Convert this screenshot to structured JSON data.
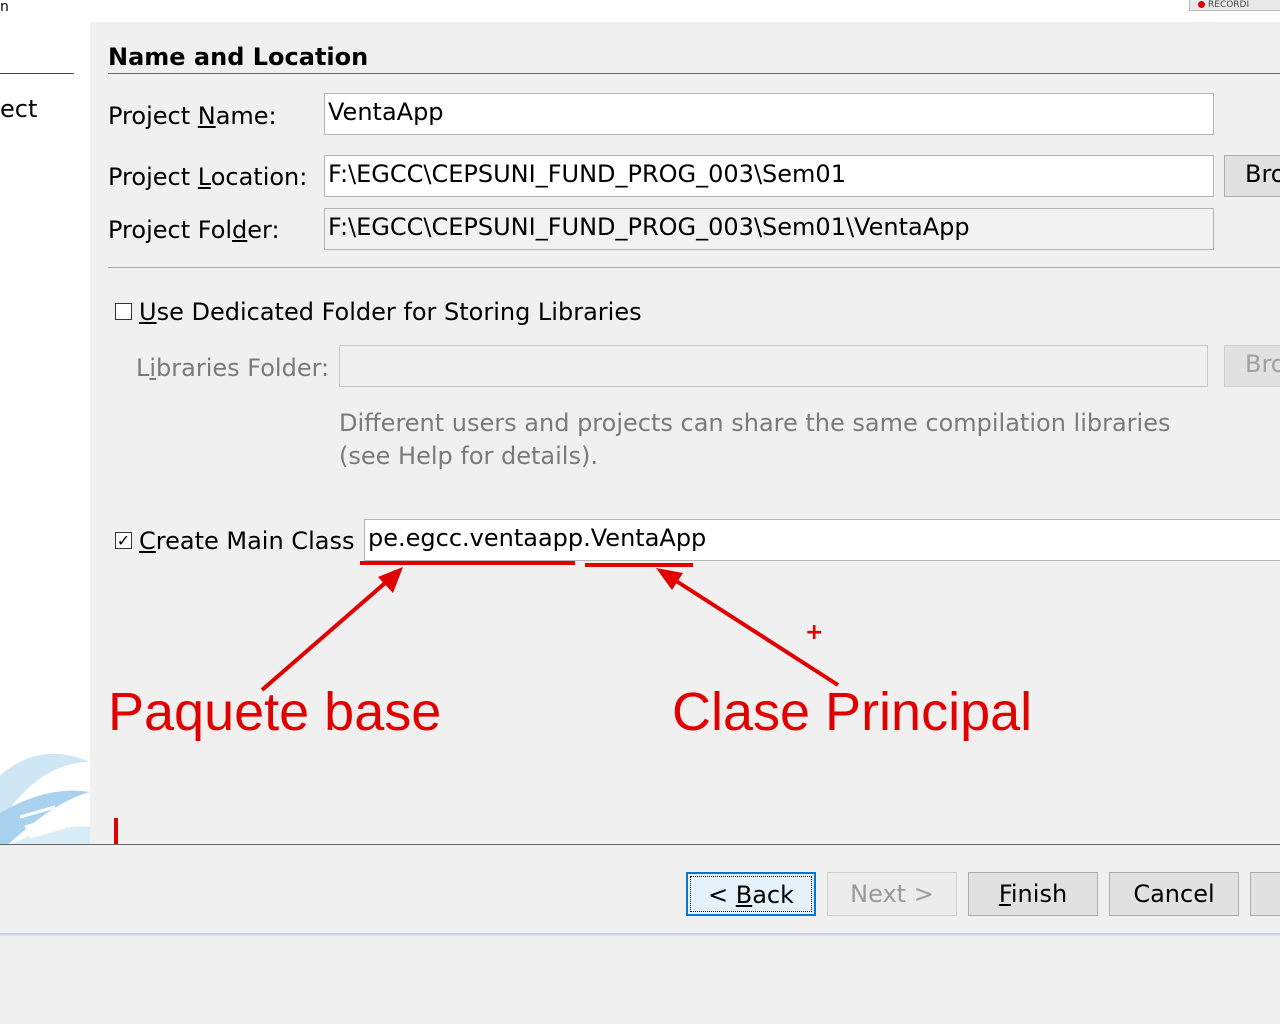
{
  "window": {
    "top_left_glyph": "n",
    "recording_badge": "RECORDI"
  },
  "wizard_steps": {
    "current_step_fragment": "ect"
  },
  "name_location": {
    "section_title": "Name and Location",
    "project_name_label_pre": "Project ",
    "project_name_label_mnemonic": "N",
    "project_name_label_post": "ame:",
    "project_name_value": "VentaApp",
    "project_location_label_pre": "Project ",
    "project_location_label_mnemonic": "L",
    "project_location_label_post": "ocation:",
    "project_location_value": "F:\\EGCC\\CEPSUNI_FUND_PROG_003\\Sem01",
    "browse_label": "Bro",
    "project_folder_label_pre": "Project Fol",
    "project_folder_label_mnemonic": "d",
    "project_folder_label_post": "er:",
    "project_folder_value": "F:\\EGCC\\CEPSUNI_FUND_PROG_003\\Sem01\\VentaApp"
  },
  "libraries": {
    "dedicated_checkbox_checked": false,
    "dedicated_label_mnemonic": "U",
    "dedicated_label_rest": "se Dedicated Folder for Storing Libraries",
    "libraries_folder_label_pre": "L",
    "libraries_folder_label_mnemonic": "i",
    "libraries_folder_label_post": "braries Folder:",
    "libraries_folder_value": "",
    "browse_label": "Bro",
    "help_line_1": "Different users and projects can share the same compilation libraries",
    "help_line_2": "(see Help for details)."
  },
  "main_class": {
    "checkbox_checked": true,
    "checkbox_glyph": "✓",
    "label_mnemonic": "C",
    "label_rest": "reate Main Class",
    "package_part": "pe.egcc.ventaapp.",
    "class_part": "VentaApp"
  },
  "annotations": {
    "package_label": "Paquete base",
    "class_label": "Clase Principal",
    "plus_mark": "+",
    "color": "#e00000"
  },
  "buttons": {
    "back_prefix": "< ",
    "back_mnemonic": "B",
    "back_rest": "ack",
    "next_label": "Next >",
    "finish_mnemonic": "F",
    "finish_rest": "inish",
    "cancel_label": "Cancel"
  },
  "colors": {
    "dialog_background": "#f0f0f0",
    "focus_border": "#0078d7",
    "annotation_red": "#e00000"
  }
}
